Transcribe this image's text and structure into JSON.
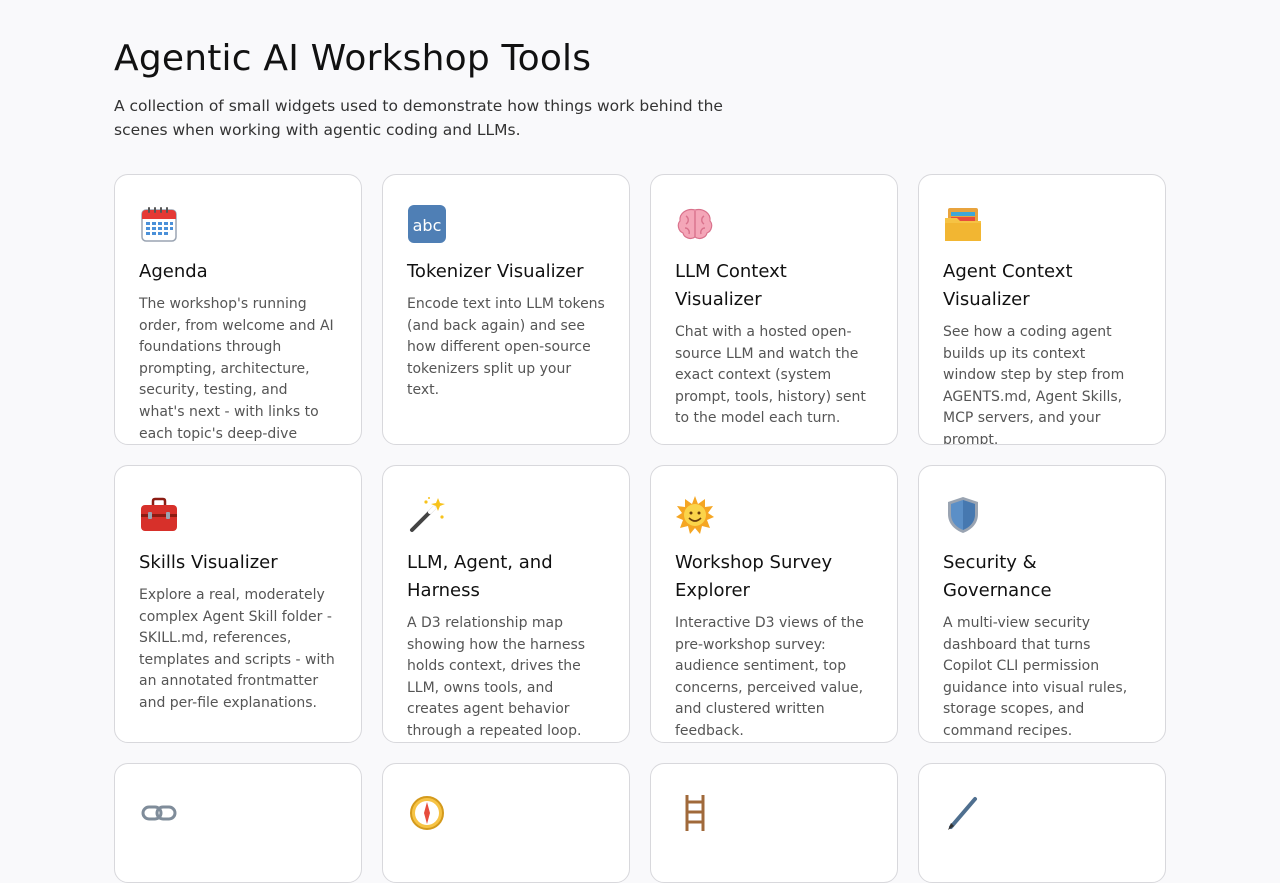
{
  "header": {
    "title": "Agentic AI Workshop Tools",
    "subtitle": "A collection of small widgets used to demonstrate how things work behind the scenes when working with agentic coding and LLMs."
  },
  "cards": [
    {
      "icon": "calendar-icon",
      "title": "Agenda",
      "description": "The workshop's running order, from welcome and AI foundations through prompting, architecture, security, testing, and what's next - with links to each topic's deep-dive widget."
    },
    {
      "icon": "abc-icon",
      "title": "Tokenizer Visualizer",
      "description": "Encode text into LLM tokens (and back again) and see how different open-source tokenizers split up your text."
    },
    {
      "icon": "brain-icon",
      "title": "LLM Context Visualizer",
      "description": "Chat with a hosted open-source LLM and watch the exact context (system prompt, tools, history) sent to the model each turn."
    },
    {
      "icon": "folders-icon",
      "title": "Agent Context Visualizer",
      "description": "See how a coding agent builds up its context window step by step from AGENTS.md, Agent Skills, MCP servers, and your prompt."
    },
    {
      "icon": "toolbox-icon",
      "title": "Skills Visualizer",
      "description": "Explore a real, moderately complex Agent Skill folder - SKILL.md, references, templates and scripts - with an annotated frontmatter and per-file explanations."
    },
    {
      "icon": "magic-wand-icon",
      "title": "LLM, Agent, and Harness",
      "description": "A D3 relationship map showing how the harness holds context, drives the LLM, owns tools, and creates agent behavior through a repeated loop."
    },
    {
      "icon": "sun-icon",
      "title": "Workshop Survey Explorer",
      "description": "Interactive D3 views of the pre-workshop survey: audience sentiment, top concerns, perceived value, and clustered written feedback."
    },
    {
      "icon": "shield-icon",
      "title": "Security & Governance",
      "description": "A multi-view security dashboard that turns Copilot CLI permission guidance into visual rules, storage scopes, and command recipes."
    }
  ],
  "partial_cards": [
    {
      "icon": "link-icon"
    },
    {
      "icon": "compass-icon"
    },
    {
      "icon": "ladder-icon"
    },
    {
      "icon": "pen-icon"
    }
  ]
}
